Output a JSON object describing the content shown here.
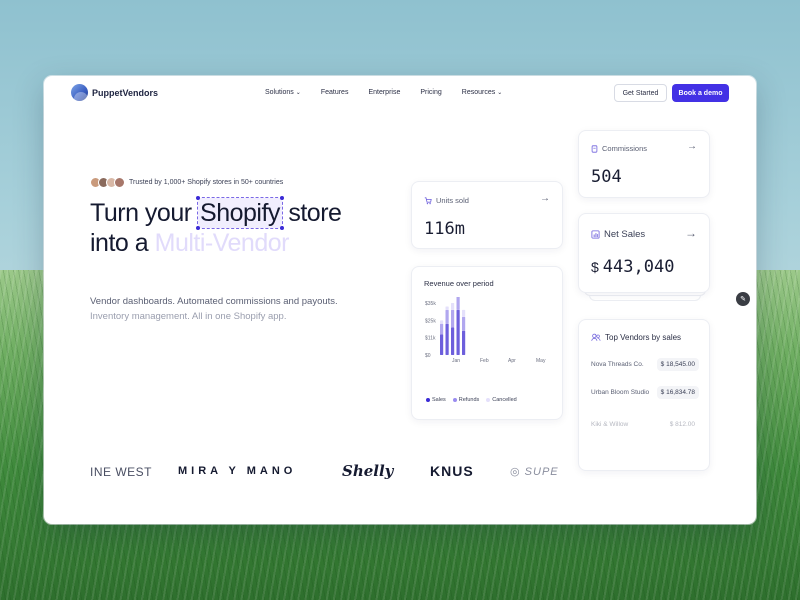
{
  "brand": {
    "name": "PuppetVendors"
  },
  "nav": {
    "items": [
      {
        "label": "Solutions",
        "dropdown": true
      },
      {
        "label": "Features",
        "dropdown": false
      },
      {
        "label": "Enterprise",
        "dropdown": false
      },
      {
        "label": "Pricing",
        "dropdown": false
      },
      {
        "label": "Resources",
        "dropdown": true
      }
    ],
    "get_started": "Get Started",
    "book_demo": "Book a demo"
  },
  "hero": {
    "trusted": "Trusted by 1,000+ Shopify stores in 50+ countries",
    "headline_part1": "Turn your",
    "headline_highlight": "Shopify",
    "headline_part2": "store",
    "headline_line2_a": "into a",
    "headline_line2_b": "Multi-Vendor",
    "sub1": "Vendor dashboards. Automated commissions and payouts.",
    "sub2": "Inventory management. All in one Shopify app."
  },
  "cards": {
    "units": {
      "title": "Units sold",
      "value": "116m",
      "icon": "cart-icon"
    },
    "commissions": {
      "title": "Commissions",
      "value": "504",
      "icon": "document-icon"
    },
    "net_sales": {
      "title": "Net Sales",
      "currency": "$",
      "value": "443,040",
      "icon": "bar-chart-icon"
    },
    "revenue": {
      "title": "Revenue over period",
      "legend": [
        "Sales",
        "Refunds",
        "Cancelled"
      ]
    },
    "vendors": {
      "title": "Top Vendors by sales",
      "rows": [
        {
          "name": "Nova Threads Co.",
          "amount": "$ 18,545.00"
        },
        {
          "name": "Urban Bloom Studio",
          "amount": "$ 16,834.78"
        },
        {
          "name": "Kiki & Willow",
          "amount": "$ 812.00"
        }
      ]
    }
  },
  "chart_data": {
    "type": "bar",
    "title": "Revenue over period",
    "y_ticks": [
      "$35k",
      "$25k",
      "$11k",
      "$0"
    ],
    "x_ticks": [
      "Jan",
      "Feb",
      "Apr",
      "May"
    ],
    "series": [
      {
        "name": "Sales",
        "color": "#6d5fdc",
        "values": [
          6,
          9,
          8,
          13,
          7
        ]
      },
      {
        "name": "Refunds",
        "color": "#b1a7ef",
        "values": [
          3,
          4,
          5,
          5,
          4
        ]
      },
      {
        "name": "Cancelled",
        "color": "#e4e0fb",
        "values": [
          1,
          1,
          2,
          2,
          2
        ]
      }
    ]
  },
  "logos": [
    "INE WEST",
    "MIRA Y MANO",
    "Shelly",
    "KNUS",
    "SUPE"
  ],
  "colors": {
    "accent": "#4331e5",
    "highlight_bg": "#f1eefe",
    "muted_headline": "#e1dbfb"
  }
}
